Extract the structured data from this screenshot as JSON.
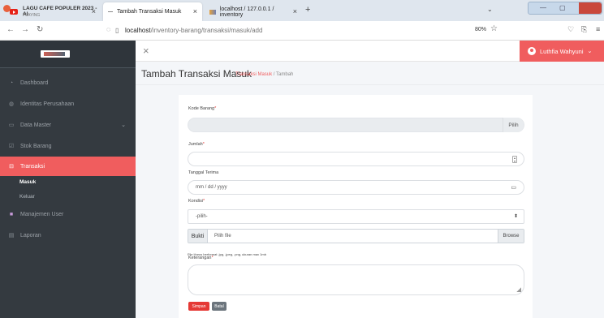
{
  "browser": {
    "tabs": [
      {
        "title": "LAGU CAFE POPULER 2023 - Al",
        "subtitle": "PLAYING"
      },
      {
        "title": "Tambah Transaksi Masuk"
      },
      {
        "title": "localhost / 127.0.0.1 / inventory"
      }
    ],
    "url_host": "localhost",
    "url_path": "/inventory-barang/transaksi/masuk/add",
    "zoom": "80%"
  },
  "sidebar": {
    "items": [
      {
        "label": "Dashboard",
        "icon": "dashboard-icon"
      },
      {
        "label": "Identitas Perusahaan",
        "icon": "building-icon"
      },
      {
        "label": "Data Master",
        "icon": "folder-icon"
      },
      {
        "label": "Stok Barang",
        "icon": "box-icon"
      },
      {
        "label": "Transaksi",
        "icon": "cart-icon"
      },
      {
        "label": "Manajemen User",
        "icon": "users-icon"
      },
      {
        "label": "Laporan",
        "icon": "report-icon"
      }
    ],
    "subitems": [
      "Masuk",
      "Keluar"
    ],
    "active_color": "#f05d5e"
  },
  "topbar": {
    "user_name": "Luthfia Wahyuni"
  },
  "page": {
    "title": "Tambah Transaksi Masuk",
    "breadcrumb_link": "Transaksi Masuk",
    "breadcrumb_sep": "/",
    "breadcrumb_current": "Tambah"
  },
  "form": {
    "kode_barang_label": "Kode Barang",
    "kode_barang_addon": "Pilih",
    "jumlah_label": "Jumlah",
    "tanggal_label": "Tanggal Terima",
    "tanggal_placeholder": "mm / dd / yyyy",
    "kondisi_label": "Kondisi",
    "kondisi_selected": "-pilih-",
    "bukti_label": "Bukti",
    "bukti_placeholder": "Pilih file",
    "bukti_browse": "Browse",
    "bukti_hint": "File Harus berformat .jpg, .jpeg, .png, ukuran max 1mb",
    "keterangan_label": "Keterangan",
    "save_label": "Simpan",
    "cancel_label": "Batal",
    "required_mark": "*"
  }
}
